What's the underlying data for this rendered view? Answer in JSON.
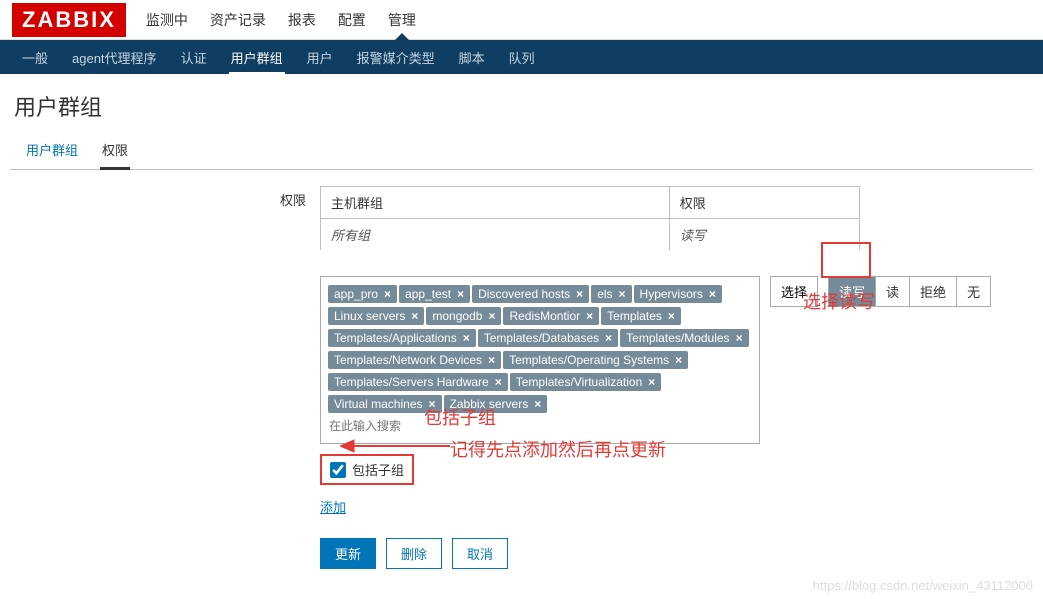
{
  "logo": "ZABBIX",
  "topnav": {
    "items": [
      "监测中",
      "资产记录",
      "报表",
      "配置",
      "管理"
    ],
    "active": 4
  },
  "subnav": {
    "items": [
      "一般",
      "agent代理程序",
      "认证",
      "用户群组",
      "用户",
      "报警媒介类型",
      "脚本",
      "队列"
    ],
    "active": 3
  },
  "page_title": "用户群组",
  "tabs": {
    "items": [
      "用户群组",
      "权限"
    ],
    "active": 1
  },
  "form": {
    "label": "权限",
    "header_col1": "主机群组",
    "header_col2": "权限",
    "body_col1": "所有组",
    "body_col2": "读写",
    "tags": [
      "app_pro",
      "app_test",
      "Discovered hosts",
      "els",
      "Hypervisors",
      "Linux servers",
      "mongodb",
      "RedisMontior",
      "Templates",
      "Templates/Applications",
      "Templates/Databases",
      "Templates/Modules",
      "Templates/Network Devices",
      "Templates/Operating Systems",
      "Templates/Servers Hardware",
      "Templates/Virtualization",
      "Virtual machines",
      "Zabbix servers"
    ],
    "input_placeholder": "在此输入搜索",
    "select_btn": "选择",
    "perm_buttons": [
      "读写",
      "读",
      "拒绝",
      "无"
    ],
    "perm_selected": 0,
    "include_label": "包括子组",
    "include_checked": true,
    "add_link": "添加",
    "update_btn": "更新",
    "delete_btn": "删除",
    "cancel_btn": "取消"
  },
  "annotations": {
    "a1": "选择读写",
    "a2": "包括子组",
    "a3": "记得先点添加然后再点更新"
  },
  "watermark": "https://blog.csdn.net/weixin_43112000"
}
